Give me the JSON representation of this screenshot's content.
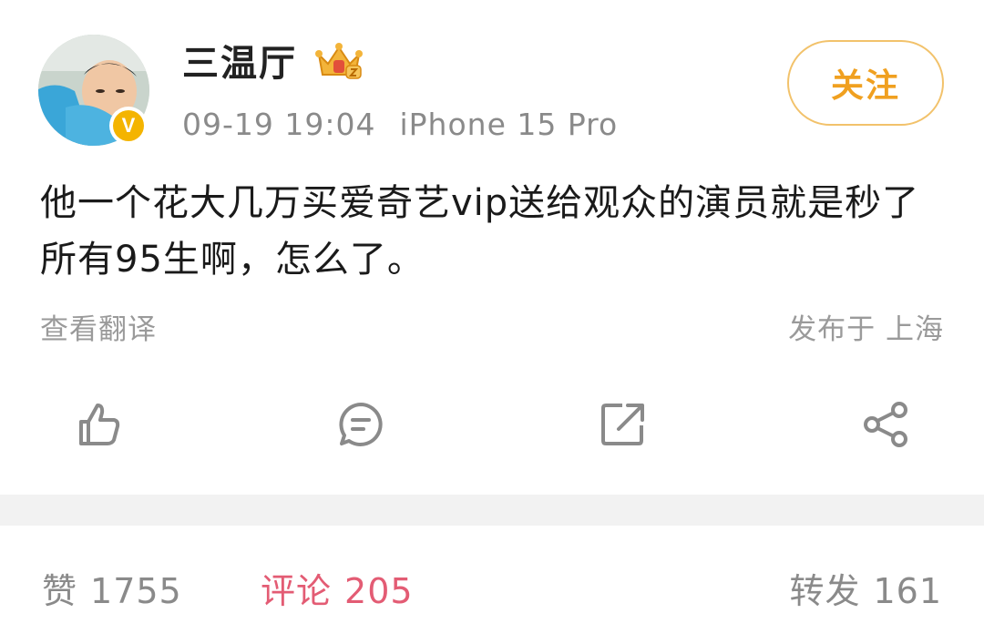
{
  "post": {
    "username": "三温厅",
    "verified_badge": "V",
    "time": "09-19 19:04",
    "device": "iPhone 15 Pro",
    "follow_label": "关注",
    "content": "他一个花大几万买爱奇艺vip送给观众的演员就是秒了所有95生啊，怎么了。",
    "translate_label": "查看翻译",
    "location": "发布于 上海"
  },
  "actions": {
    "like_icon": "thumbs-up-icon",
    "comment_icon": "comment-icon",
    "repost_icon": "repost-icon",
    "share_icon": "share-icon"
  },
  "stats": {
    "likes_label": "赞",
    "likes_count": "1755",
    "comments_label": "评论",
    "comments_count": "205",
    "reposts_label": "转发",
    "reposts_count": "161"
  },
  "colors": {
    "accent_orange": "#f0a020",
    "follow_border": "#f2c26b",
    "active_tab": "#e35c74",
    "muted_text": "#8a8a8a",
    "divider": "#f2f2f2"
  }
}
